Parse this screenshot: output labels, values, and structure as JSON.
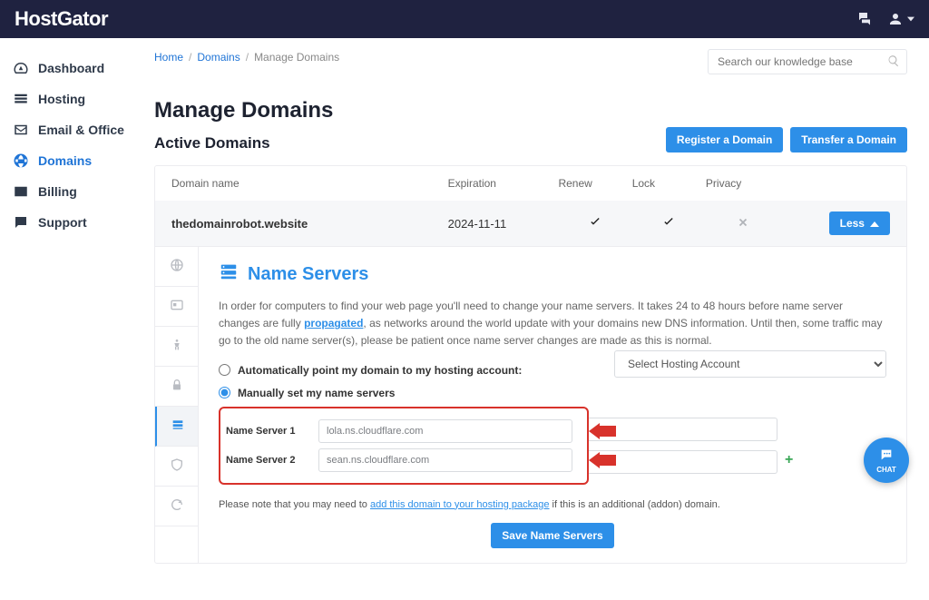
{
  "brand": "HostGator",
  "topbar_icons": {
    "chat": "chat-bubbles-icon",
    "user": "user-icon"
  },
  "sidebar": {
    "items": [
      {
        "label": "Dashboard",
        "name": "sidebar-item-dashboard"
      },
      {
        "label": "Hosting",
        "name": "sidebar-item-hosting"
      },
      {
        "label": "Email & Office",
        "name": "sidebar-item-email-office"
      },
      {
        "label": "Domains",
        "name": "sidebar-item-domains",
        "active": true
      },
      {
        "label": "Billing",
        "name": "sidebar-item-billing"
      },
      {
        "label": "Support",
        "name": "sidebar-item-support"
      }
    ]
  },
  "breadcrumbs": {
    "home": "Home",
    "domains": "Domains",
    "current": "Manage Domains"
  },
  "search": {
    "placeholder": "Search our knowledge base"
  },
  "page_title": "Manage Domains",
  "section_title": "Active Domains",
  "actions": {
    "register": "Register a Domain",
    "transfer": "Transfer a Domain"
  },
  "table": {
    "headers": {
      "domain": "Domain name",
      "expiration": "Expiration",
      "renew": "Renew",
      "lock": "Lock",
      "privacy": "Privacy"
    },
    "row": {
      "domain": "thedomainrobot.website",
      "expiration": "2024-11-11",
      "renew_icon": "check-icon",
      "lock_icon": "check-icon",
      "privacy_icon": "x-icon",
      "toggle_label": "Less",
      "toggle_icon": "chevron-up-icon"
    }
  },
  "detail_tabs": [
    {
      "name": "tab-overview",
      "icon": "globe-icon"
    },
    {
      "name": "tab-contacts",
      "icon": "card-icon"
    },
    {
      "name": "tab-transfer",
      "icon": "body-icon"
    },
    {
      "name": "tab-lock",
      "icon": "lock-icon"
    },
    {
      "name": "tab-nameservers",
      "icon": "server-lines-icon",
      "active": true
    },
    {
      "name": "tab-privacy",
      "icon": "shield-icon"
    },
    {
      "name": "tab-refresh",
      "icon": "refresh-icon"
    }
  ],
  "ns": {
    "title": "Name Servers",
    "desc_prefix": "In order for computers to find your web page you'll need to change your name servers. It takes 24 to 48 hours before name server changes are fully ",
    "desc_link": "propagated",
    "desc_suffix": ", as networks around the world update with your domains new DNS information. Until then, some traffic may go to the old name server(s), please be patient once name server changes are made as this is normal.",
    "radio_auto": "Automatically point my domain to my hosting account:",
    "select_hosting": "Select Hosting Account",
    "radio_manual": "Manually set my name servers",
    "fields": [
      {
        "label": "Name Server 1",
        "value": "lola.ns.cloudflare.com"
      },
      {
        "label": "Name Server 2",
        "value": "sean.ns.cloudflare.com"
      }
    ],
    "add_icon": "plus-icon",
    "note_prefix": "Please note that you may need to ",
    "note_link": "add this domain to your hosting package",
    "note_suffix": " if this is an additional (addon) domain.",
    "save_label": "Save Name Servers"
  },
  "chat_fab": {
    "label": "CHAT",
    "icon": "chat-icon"
  },
  "colors": {
    "accent": "#2d8fe8",
    "topbar": "#1f2240",
    "annotation": "#d8322b"
  }
}
